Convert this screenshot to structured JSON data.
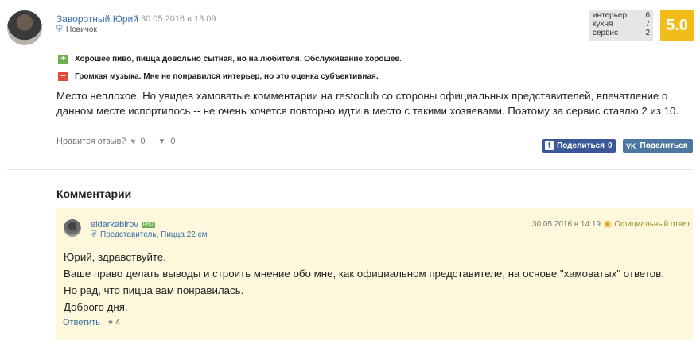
{
  "review": {
    "author": "Заворотный Юрий",
    "date": "30.05.2016 в 13:09",
    "rank": "Новичок",
    "scores": [
      {
        "label": "интерьер",
        "value": "6"
      },
      {
        "label": "кухня",
        "value": "7"
      },
      {
        "label": "сервис",
        "value": "2"
      }
    ],
    "total": "5.0",
    "pros": "Хорошее пиво, пицца довольно сытная, но на любителя. Обслуживание хорошее.",
    "cons": "Громкая музыка. Мне не понравился интерьер, но это оценка субъективная.",
    "text": "Место неплохое. Но увидев хамоватые комментарии на restoclub со стороны официальных представителей, впечатление о данном месте испортилось -- не очень хочется повторно идти в место с такими хозяевами. Поэтому за сервис ставлю 2 из 10.",
    "like_prompt": "Нравится отзыв?",
    "likes": "0",
    "dislikes": "0",
    "share_fb_label": "Поделиться",
    "share_fb_count": "0",
    "share_vk_label": "Поделиться",
    "colors": {
      "score_accent": "#f2bd1b",
      "pros": "#6ab04c",
      "cons": "#e04a3b",
      "fb": "#3b5998",
      "vk": "#4d76a1",
      "comment_bg": "#fdf8dc"
    }
  },
  "comments": {
    "title": "Комментарии",
    "items": [
      {
        "author": "eldarkabirov",
        "badge": "PRO",
        "role": "Представитель, Пицца 22 см",
        "date": "30.05.2016 в 14:19",
        "official": "Официальный ответ",
        "lines": [
          "Юрий, здравствуйте.",
          "Ваше право делать выводы и строить мнение обо мне, как официальном представителе, на основе \"хамоватых\" ответов.",
          "Но рад, что пицца вам понравилась.",
          "Доброго дня."
        ],
        "reply_label": "Ответить",
        "likes": "4"
      }
    ]
  }
}
